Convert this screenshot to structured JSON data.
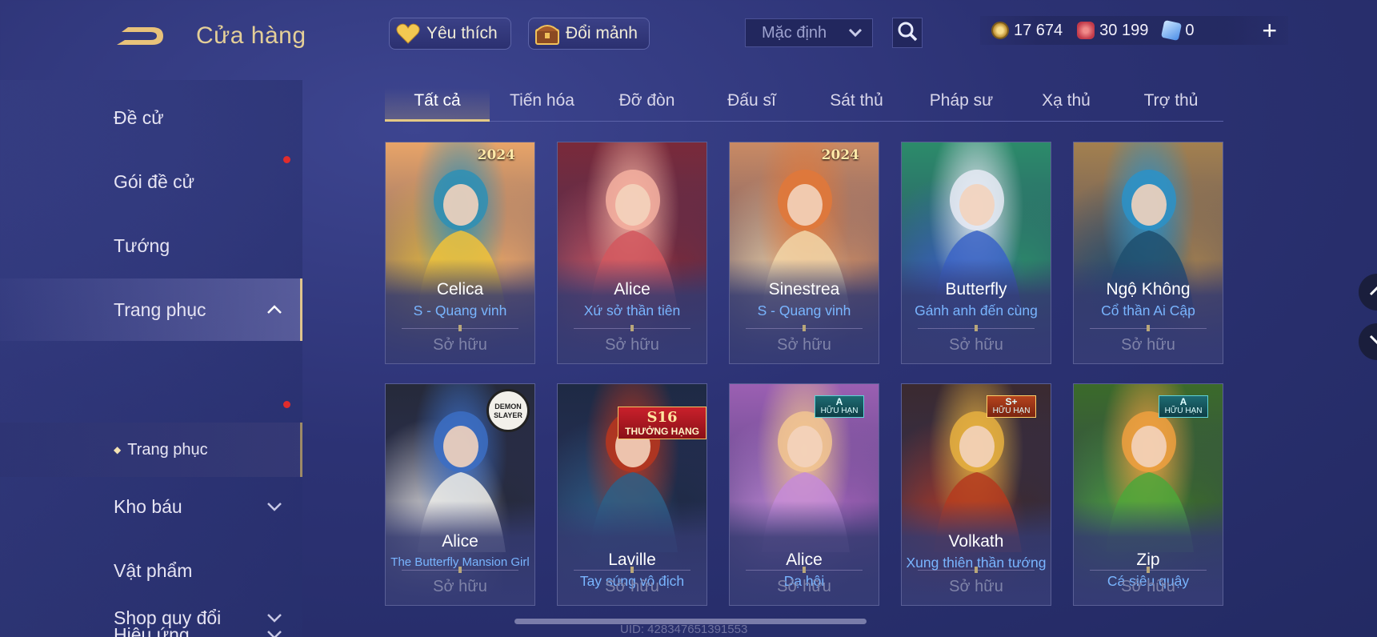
{
  "header": {
    "title": "Cửa hàng",
    "favorites_label": "Yêu thích",
    "exchange_label": "Đổi mảnh",
    "sort_value": "Mặc định",
    "currencies": [
      {
        "icon": "gold-coin-icon",
        "value": "17 674",
        "color": "#d9b35a"
      },
      {
        "icon": "red-voucher-icon",
        "value": "30 199",
        "color": "#d6495b"
      },
      {
        "icon": "blue-gem-icon",
        "value": "0",
        "color": "#6fb6ff"
      }
    ],
    "plus_label": "+"
  },
  "sidebar": {
    "items": [
      {
        "label": "Đề cử"
      },
      {
        "label": "Gói đề cử"
      },
      {
        "label": "Tướng"
      },
      {
        "label": "Trang phục"
      },
      {
        "label": "Kho báu"
      },
      {
        "label": "Vật phẩm"
      },
      {
        "label": "Hiệu ứng"
      },
      {
        "label": "Shop quy đổi"
      }
    ],
    "sub_item": "Trang phục"
  },
  "tabs": [
    "Tất cả",
    "Tiến hóa",
    "Đỡ đòn",
    "Đấu sĩ",
    "Sát thủ",
    "Pháp sư",
    "Xạ thủ",
    "Trợ thủ"
  ],
  "cards": [
    {
      "name": "Celica",
      "skin": "S - Quang vinh",
      "owned": "Sở hữu",
      "badge_year": "2024",
      "palette": [
        "#f1c23a",
        "#2e8fb5",
        "#e8a468"
      ]
    },
    {
      "name": "Alice",
      "skin": "Xứ sở thần tiên",
      "owned": "Sở hữu",
      "palette": [
        "#d2575e",
        "#f4b0a0",
        "#7a2a3a"
      ]
    },
    {
      "name": "Sinestrea",
      "skin": "S - Quang vinh",
      "owned": "Sở hữu",
      "badge_year": "2024",
      "palette": [
        "#f2d6a8",
        "#e0783a",
        "#c98a64"
      ]
    },
    {
      "name": "Butterfly",
      "skin": "Gánh anh đến cùng",
      "owned": "Sở hữu",
      "palette": [
        "#3a63c6",
        "#e6eaf4",
        "#2c8b6a"
      ]
    },
    {
      "name": "Ngộ Không",
      "skin": "Cổ thần Ai Cập",
      "owned": "Sở hữu",
      "palette": [
        "#1f4f6e",
        "#2c92c8",
        "#a3804f"
      ]
    },
    {
      "name": "Alice",
      "skin": "The Butterfly Mansion Girl",
      "owned": "Sở hữu",
      "badge_text": "DEMON SLAYER",
      "palette": [
        "#f0ede6",
        "#3c6ec4",
        "#262a3a"
      ]
    },
    {
      "name": "Laville",
      "skin": "Tay súng vô địch",
      "owned": "Sở hữu",
      "badge_season": "S16",
      "badge_text": "THƯỞNG HẠNG",
      "palette": [
        "#2d5f86",
        "#b7361f",
        "#1e2a44"
      ]
    },
    {
      "name": "Alice",
      "skin": "Dạ hội",
      "owned": "Sở hữu",
      "rank": "A",
      "rank_text": "HỮU HẠN",
      "palette": [
        "#c68bd8",
        "#f2c590",
        "#9b5fb2"
      ]
    },
    {
      "name": "Volkath",
      "skin": "Xung thiên thần tướng",
      "owned": "Sở hữu",
      "rank": "S+",
      "rank_text": "HỮU HẠN",
      "palette": [
        "#b4391f",
        "#e6b040",
        "#3b2a30"
      ]
    },
    {
      "name": "Zip",
      "skin": "Cá siêu quậy",
      "owned": "Sở hữu",
      "rank": "A",
      "rank_text": "HỮU HẠN",
      "palette": [
        "#4ea63a",
        "#f0a040",
        "#3b6a2a"
      ]
    }
  ],
  "footer": {
    "uid": "UID: 428347651391553"
  }
}
